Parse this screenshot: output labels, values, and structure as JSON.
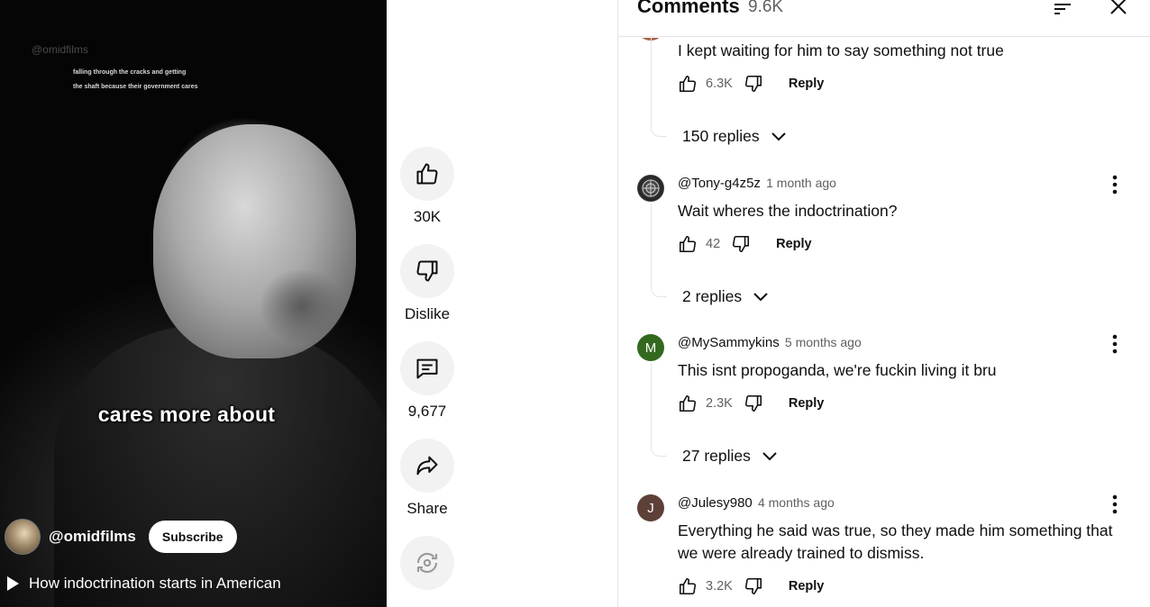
{
  "video": {
    "watermark": "@omidfilms",
    "small_caption_line1": "falling through the cracks and getting",
    "small_caption_line2": "the shaft because their government cares",
    "caption": "cares more about",
    "channel_name": "@omidfilms",
    "subscribe_label": "Subscribe",
    "title": "How indoctrination starts in American"
  },
  "actions": {
    "like_count": "30K",
    "dislike_label": "Dislike",
    "comment_count": "9,677",
    "share_label": "Share"
  },
  "comments_panel": {
    "title": "Comments",
    "count": "9.6K",
    "top_comment": {
      "text": "I kept waiting for him to say something not true",
      "likes": "6.3K",
      "reply_label": "Reply",
      "replies_label": "150 replies"
    },
    "comments": [
      {
        "author": "@Tony-g4z5z",
        "time": "1 month ago",
        "text": "Wait wheres the indoctrination?",
        "likes": "42",
        "reply_label": "Reply",
        "replies_label": "2 replies",
        "avatar_letter": "",
        "avatar_color": "#2a2a2a"
      },
      {
        "author": "@MySammykins",
        "time": "5 months ago",
        "text": "This isnt propoganda, we're fuckin living it bru",
        "likes": "2.3K",
        "reply_label": "Reply",
        "replies_label": "27 replies",
        "avatar_letter": "M",
        "avatar_color": "#33691e"
      },
      {
        "author": "@Julesy980",
        "time": "4 months ago",
        "text": "Everything he said was true, so they made him something that we were already trained to dismiss.",
        "likes": "3.2K",
        "reply_label": "Reply",
        "avatar_letter": "J",
        "avatar_color": "#5d4037"
      }
    ]
  }
}
